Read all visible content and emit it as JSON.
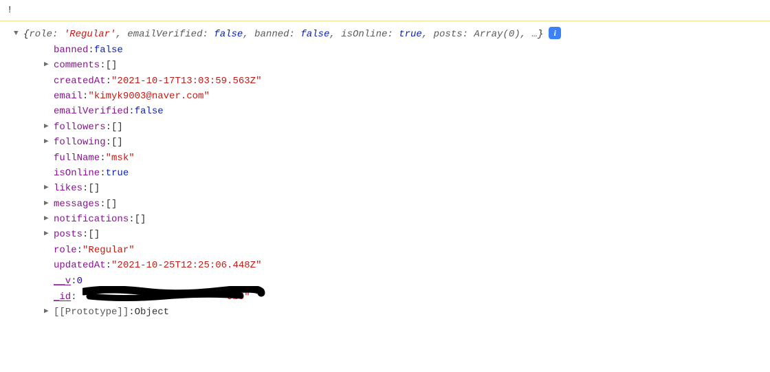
{
  "warning": "!",
  "summary": {
    "open": "{",
    "role_key": "role: ",
    "role_val": "'Regular'",
    "emailVerified_key": "emailVerified: ",
    "emailVerified_val": "false",
    "banned_key": "banned: ",
    "banned_val": "false",
    "isOnline_key": "isOnline: ",
    "isOnline_val": "true",
    "posts_key": "posts: ",
    "posts_val": "Array(0)",
    "ellipsis": "…",
    "close": "}"
  },
  "props": {
    "banned_key": "banned",
    "banned_val": "false",
    "comments_key": "comments",
    "comments_val": "[]",
    "createdAt_key": "createdAt",
    "createdAt_val": "\"2021-10-17T13:03:59.563Z\"",
    "email_key": "email",
    "email_val": "\"kimyk9003@naver.com\"",
    "emailVerified_key": "emailVerified",
    "emailVerified_val": "false",
    "followers_key": "followers",
    "followers_val": "[]",
    "following_key": "following",
    "following_val": "[]",
    "fullName_key": "fullName",
    "fullName_val": "\"msk\"",
    "isOnline_key": "isOnline",
    "isOnline_val": "true",
    "likes_key": "likes",
    "likes_val": "[]",
    "messages_key": "messages",
    "messages_val": "[]",
    "notifications_key": "notifications",
    "notifications_val": "[]",
    "posts_key": "posts",
    "posts_val": "[]",
    "role_key": "role",
    "role_val": "\"Regular\"",
    "updatedAt_key": "updatedAt",
    "updatedAt_val": "\"2021-10-25T12:25:06.448Z\"",
    "v_key": "__v",
    "v_val": "0",
    "id_key": "_id",
    "id_visible_tail": "9b5\"",
    "proto_key": "[[Prototype]]",
    "proto_val": "Object"
  },
  "colon": ": ",
  "comma": ", "
}
